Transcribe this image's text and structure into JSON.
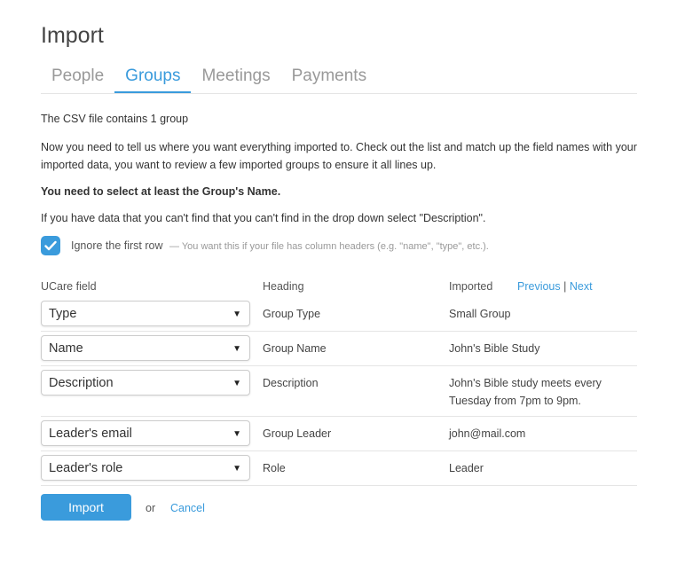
{
  "page": {
    "title": "Import"
  },
  "tabs": [
    {
      "label": "People"
    },
    {
      "label": "Groups",
      "active": true
    },
    {
      "label": "Meetings"
    },
    {
      "label": "Payments"
    }
  ],
  "intro": {
    "summary": "The CSV file contains 1 group",
    "instructions": "Now you need to tell us where you want everything imported to. Check out the list and match up the field names with your imported data, you want to review a few imported groups to ensure it all lines up.",
    "requirement": "You need to select at least the Group's Name.",
    "hint": "If you have data that you can't find that you can't find in the drop down select \"Description\"."
  },
  "ignore_first_row": {
    "label": "Ignore the first row",
    "hint": "— You want this if your file has column headers (e.g. \"name\", \"type\", etc.).",
    "checked": true
  },
  "table": {
    "headers": {
      "field": "UCare field",
      "heading": "Heading",
      "imported": "Imported"
    },
    "pager": {
      "previous": "Previous",
      "separator": "|",
      "next": "Next"
    },
    "rows": [
      {
        "field": "Type",
        "heading": "Group Type",
        "imported": "Small Group"
      },
      {
        "field": "Name",
        "heading": "Group Name",
        "imported": "John's Bible Study"
      },
      {
        "field": "Description",
        "heading": "Description",
        "imported": "John's Bible study meets every Tuesday from 7pm to 9pm."
      },
      {
        "field": "Leader's email",
        "heading": "Group Leader",
        "imported": "john@mail.com"
      },
      {
        "field": "Leader's role",
        "heading": "Role",
        "imported": "Leader"
      }
    ]
  },
  "actions": {
    "import": "Import",
    "or": "or",
    "cancel": "Cancel"
  },
  "colors": {
    "accent": "#3a9bdc",
    "border": "#e5e5e5"
  },
  "icons": {
    "checkbox": "checkmark-icon",
    "select": "triangle-down-icon"
  }
}
